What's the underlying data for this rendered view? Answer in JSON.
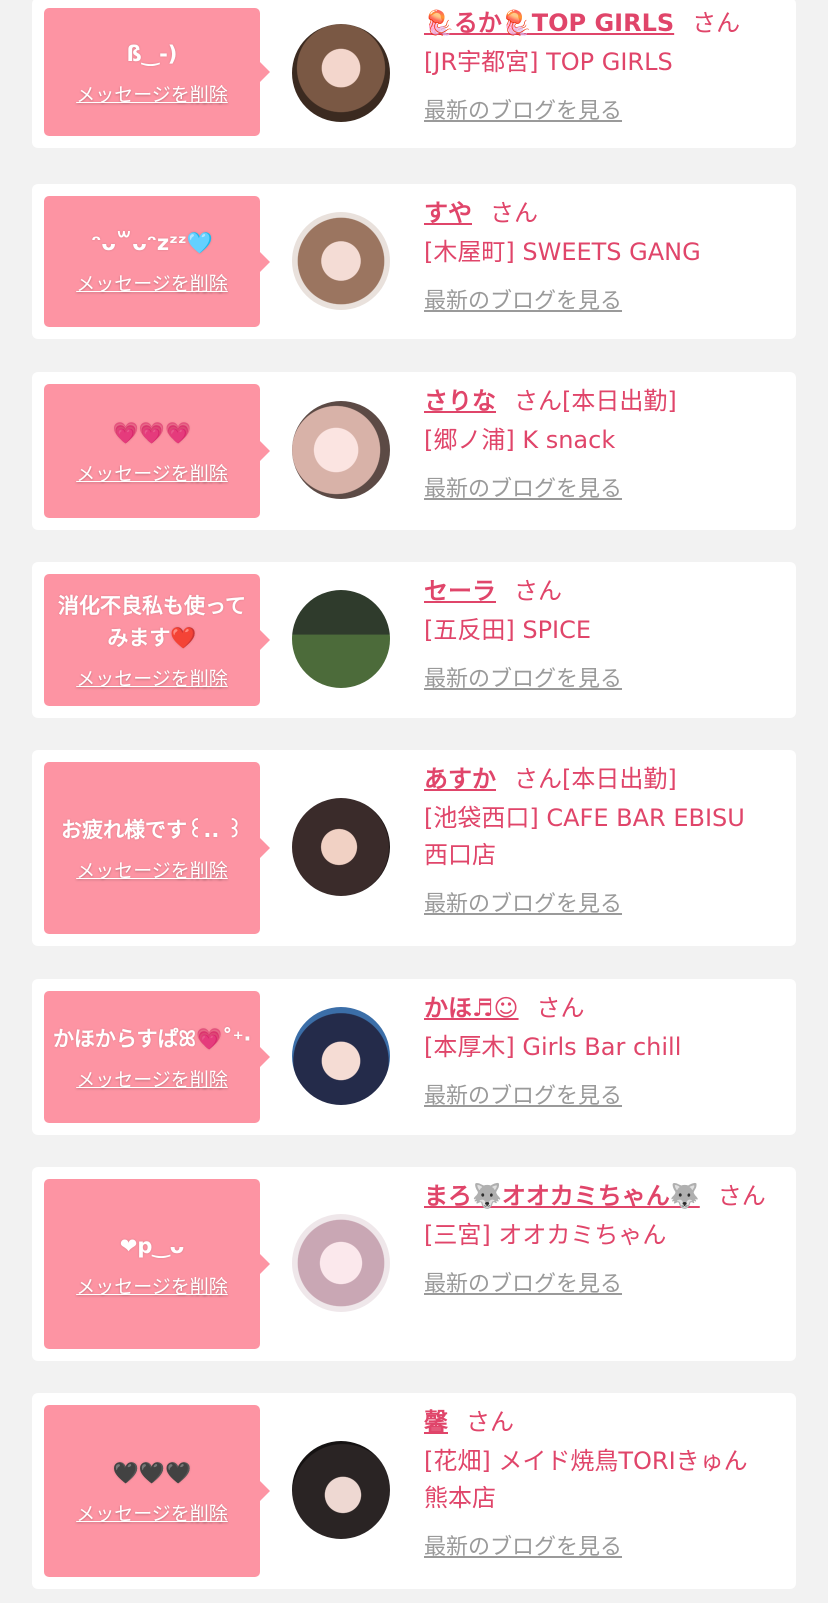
{
  "delete_label": "メッセージを削除",
  "blog_label": "最新のブログを見る",
  "san_label": "さん",
  "colors": {
    "accent": "#e0456a",
    "bubble": "#fd94a3",
    "background": "#f2f2f2",
    "card": "#ffffff",
    "link_gray": "#9a9a9a"
  },
  "entries": [
    {
      "message": "ß‿-)",
      "name": "🪼るか🪼TOP GIRLS",
      "badge": "",
      "shop": "[JR宇都宮] TOP GIRLS"
    },
    {
      "message": "ᵔᴗ꒳ᴗᵔzᶻᶻ🩵",
      "name": "すや",
      "badge": "",
      "shop": "[木屋町] SWEETS GANG"
    },
    {
      "message": "💗💗💗",
      "name": "さりな",
      "badge": "[本日出勤]",
      "shop": "[郷ノ浦] K snack"
    },
    {
      "message": "消化不良私も使ってみます❤️",
      "name": "セーラ",
      "badge": "",
      "shop": "[五反田] SPICE"
    },
    {
      "message": "お疲れ様です꒰.. ꒱",
      "name": "あすか",
      "badge": "[本日出勤]",
      "shop": "[池袋西口] CAFE BAR EBISU 西口店"
    },
    {
      "message": "かほからすぱꕤ💗˚⁺‧",
      "name": "かほ♬☺︎",
      "badge": "",
      "shop": "[本厚木] Girls Bar chill"
    },
    {
      "message": "❤︎p‿ᴗ",
      "name": "まろ🐺オオカミちゃん🐺",
      "badge": "",
      "shop": "[三宮] オオカミちゃん"
    },
    {
      "message": "🖤🖤🖤",
      "name": "馨",
      "badge": "",
      "shop": "[花畑] メイド焼鳥TORIきゅん 熊本店"
    }
  ]
}
